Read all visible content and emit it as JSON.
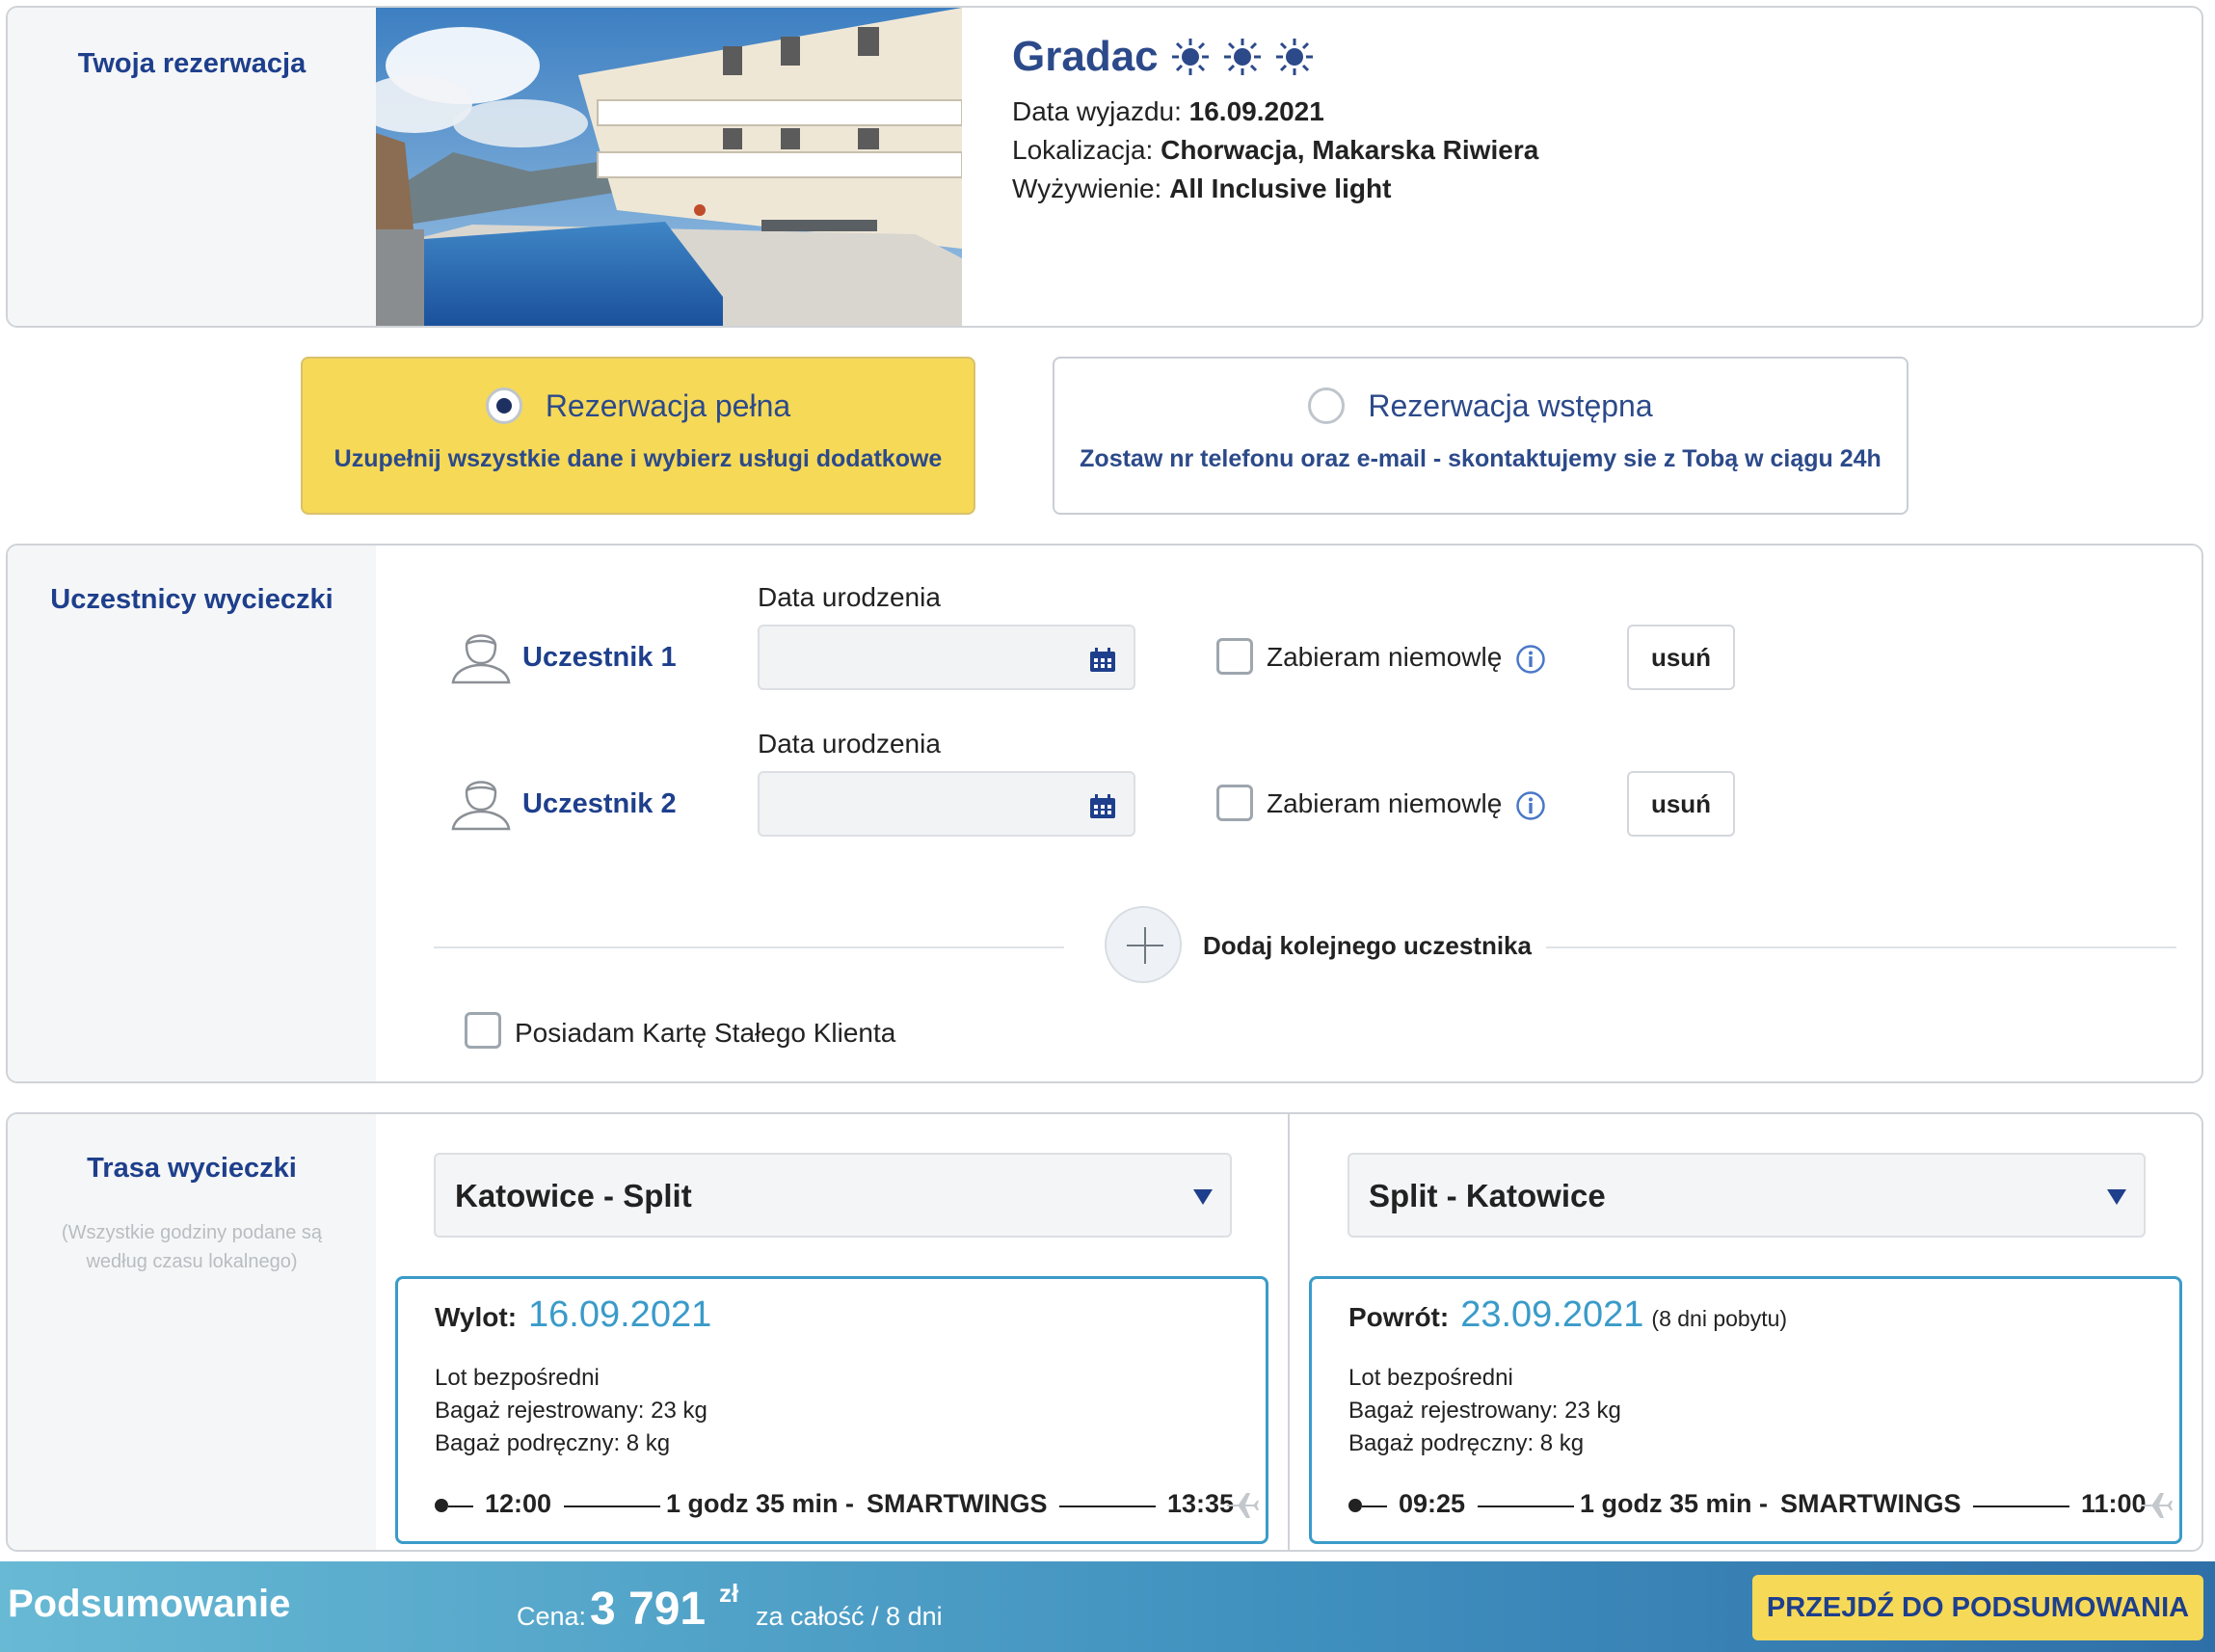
{
  "booking": {
    "section_title": "Twoja rezerwacja",
    "hotel_name": "Gradac",
    "sun_rating": 3,
    "departure_label": "Data wyjazdu:",
    "departure_value": "16.09.2021",
    "location_label": "Lokalizacja:",
    "location_value": "Chorwacja, Makarska Riwiera",
    "board_label": "Wyżywienie:",
    "board_value": "All Inclusive light"
  },
  "options": {
    "full_title": "Rezerwacja pełna",
    "full_sub": "Uzupełnij wszystkie dane i wybierz usługi dodatkowe",
    "pre_title": "Rezerwacja wstępna",
    "pre_sub": "Zostaw nr telefonu oraz e-mail - skontaktujemy sie z Tobą w ciągu 24h",
    "selected": "full"
  },
  "participants": {
    "section_title": "Uczestnicy wycieczki",
    "items": [
      {
        "name": "Uczestnik 1",
        "dob_label": "Data urodzenia",
        "dob_value": "",
        "infant_label": "Zabieram niemowlę",
        "infant_checked": false,
        "remove_label": "usuń"
      },
      {
        "name": "Uczestnik 2",
        "dob_label": "Data urodzenia",
        "dob_value": "",
        "infant_label": "Zabieram niemowlę",
        "infant_checked": false,
        "remove_label": "usuń"
      }
    ],
    "add_label": "Dodaj kolejnego uczestnika",
    "loyalty_label": "Posiadam Kartę Stałego Klienta",
    "loyalty_checked": false
  },
  "route": {
    "section_title": "Trasa wycieczki",
    "note": "(Wszystkie godziny podane są według czasu lokalnego)",
    "outbound": {
      "select_value": "Katowice - Split",
      "label": "Wylot:",
      "date": "16.09.2021",
      "stay": "",
      "lines": [
        "Lot bezpośredni",
        "Bagaż rejestrowany: 23 kg",
        "Bagaż podręczny: 8 kg"
      ],
      "dep_time": "12:00",
      "duration": "1 godz 35 min",
      "separator": "-",
      "carrier": "SMARTWINGS",
      "arr_time": "13:35"
    },
    "return": {
      "select_value": "Split - Katowice",
      "label": "Powrót:",
      "date": "23.09.2021",
      "stay": "(8 dni pobytu)",
      "lines": [
        "Lot bezpośredni",
        "Bagaż rejestrowany: 23 kg",
        "Bagaż podręczny: 8 kg"
      ],
      "dep_time": "09:25",
      "duration": "1 godz 35 min",
      "separator": "-",
      "carrier": "SMARTWINGS",
      "arr_time": "11:00"
    }
  },
  "summary": {
    "title": "Podsumowanie",
    "price_label": "Cena:",
    "price_value": "3 791",
    "currency": "zł",
    "price_note": "za całość / 8 dni",
    "cta": "PRZEJDŹ DO PODSUMOWANIA"
  },
  "colors": {
    "brand_blue": "#1e3f8c",
    "accent_teal": "#3a9bc9",
    "accent_yellow": "#f6d957"
  }
}
